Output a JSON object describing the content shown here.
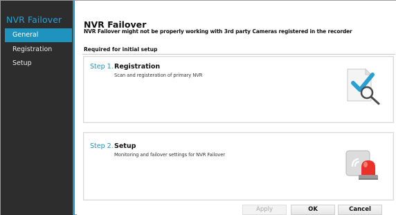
{
  "sidebar": {
    "title": "NVR Failover",
    "items": [
      {
        "label": "General",
        "active": true
      },
      {
        "label": "Registration",
        "active": false
      },
      {
        "label": "Setup",
        "active": false
      }
    ],
    "colors": {
      "background": "#2d2d2d",
      "accent": "#1d93be"
    }
  },
  "main": {
    "title": "NVR Failover",
    "subtitle": "NVR Failover might not be properly working with 3rd party Cameras registered in the recorder",
    "section_label": "Required for initial setup",
    "steps": [
      {
        "number": "Step 1.",
        "name": "Registration",
        "description": "Scan and registeration of primary NVR",
        "icon": "document-magnifier-check-icon"
      },
      {
        "number": "Step 2.",
        "name": "Setup",
        "description": "Monitoring and failover settings for NVR Failover",
        "icon": "alarm-siren-icon"
      }
    ]
  },
  "footer": {
    "apply_label": "Apply",
    "ok_label": "OK",
    "cancel_label": "Cancel",
    "apply_enabled": false
  }
}
